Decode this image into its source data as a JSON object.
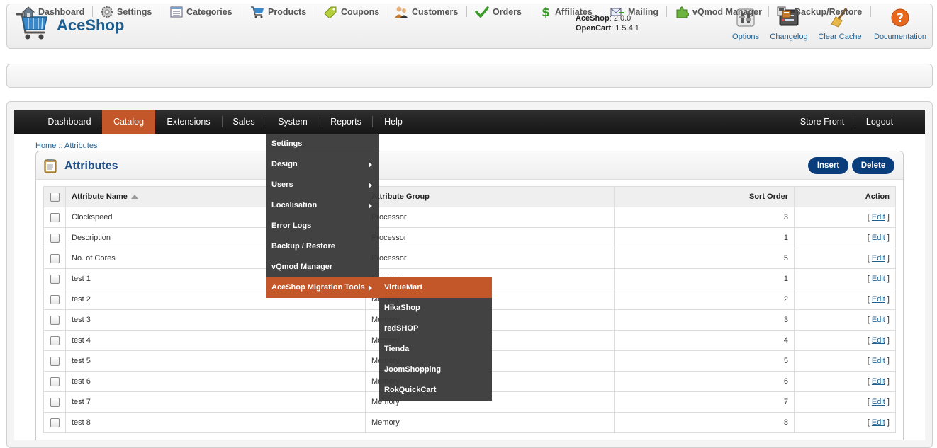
{
  "header": {
    "logo": "AceShop",
    "versions": [
      {
        "name": "AceShop",
        "value": "2.0.0"
      },
      {
        "name": "OpenCart",
        "value": "1.5.4.1"
      }
    ],
    "tools": [
      {
        "label": "Options",
        "icon": "options-icon"
      },
      {
        "label": "Changelog",
        "icon": "changelog-icon"
      },
      {
        "label": "Clear Cache",
        "icon": "broom-icon"
      },
      {
        "label": "Documentation",
        "icon": "help-icon"
      }
    ]
  },
  "toolbar": {
    "items": [
      {
        "label": "Dashboard",
        "icon": "home-icon"
      },
      {
        "label": "Settings",
        "icon": "gear-icon"
      },
      {
        "label": "Categories",
        "icon": "categories-icon"
      },
      {
        "label": "Products",
        "icon": "cart-icon"
      },
      {
        "label": "Coupons",
        "icon": "coupon-icon"
      },
      {
        "label": "Customers",
        "icon": "users-icon"
      },
      {
        "label": "Orders",
        "icon": "check-icon"
      },
      {
        "label": "Affiliates",
        "icon": "dollar-icon"
      },
      {
        "label": "Mailing",
        "icon": "mail-icon"
      },
      {
        "label": "vQmod Manager",
        "icon": "puzzle-icon"
      },
      {
        "label": "Backup/Restore",
        "icon": "backup-icon"
      }
    ]
  },
  "menubar": {
    "left": [
      "Dashboard",
      "Catalog",
      "Extensions",
      "Sales",
      "System",
      "Reports",
      "Help"
    ],
    "active": "Catalog",
    "right": [
      "Store Front",
      "Logout"
    ]
  },
  "breadcrumb": {
    "home": "Home",
    "sep": "::",
    "current": "Attributes"
  },
  "panel": {
    "title": "Attributes",
    "insert_label": "Insert",
    "delete_label": "Delete"
  },
  "table": {
    "headers": [
      "Attribute Name",
      "Attribute Group",
      "Sort Order",
      "Action"
    ],
    "edit_label": "Edit",
    "rows": [
      {
        "name": "Clockspeed",
        "group": "Processor",
        "sort": "3"
      },
      {
        "name": "Description",
        "group": "Processor",
        "sort": "1"
      },
      {
        "name": "No. of Cores",
        "group": "Processor",
        "sort": "5"
      },
      {
        "name": "test 1",
        "group": "Memory",
        "sort": "1"
      },
      {
        "name": "test 2",
        "group": "Memory",
        "sort": "2"
      },
      {
        "name": "test 3",
        "group": "Memory",
        "sort": "3"
      },
      {
        "name": "test 4",
        "group": "Memory",
        "sort": "4"
      },
      {
        "name": "test 5",
        "group": "Memory",
        "sort": "5"
      },
      {
        "name": "test 6",
        "group": "Memory",
        "sort": "6"
      },
      {
        "name": "test 7",
        "group": "Memory",
        "sort": "7"
      },
      {
        "name": "test 8",
        "group": "Memory",
        "sort": "8"
      }
    ]
  },
  "system_menu": {
    "items": [
      {
        "label": "Settings",
        "has_sub": false
      },
      {
        "label": "Design",
        "has_sub": true
      },
      {
        "label": "Users",
        "has_sub": true
      },
      {
        "label": "Localisation",
        "has_sub": true
      },
      {
        "label": "Error Logs",
        "has_sub": false
      },
      {
        "label": "Backup / Restore",
        "has_sub": false
      },
      {
        "label": "vQmod Manager",
        "has_sub": false
      },
      {
        "label": "AceShop Migration Tools",
        "has_sub": true
      }
    ],
    "active_index": 7
  },
  "migration_menu": {
    "items": [
      "VirtueMart",
      "HikaShop",
      "redSHOP",
      "Tienda",
      "JoomShopping",
      "RokQuickCart"
    ],
    "active_index": 0
  },
  "colors": {
    "accent": "#c4572a",
    "brand": "#1d5e90",
    "button": "#0a3d7c"
  }
}
